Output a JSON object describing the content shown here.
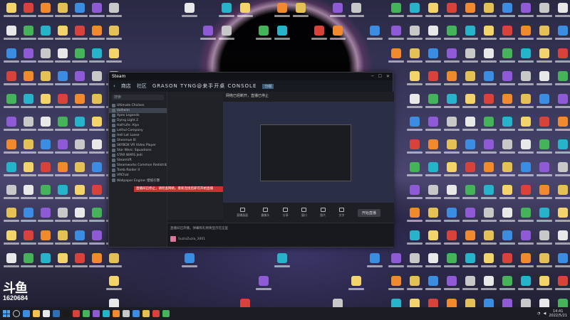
{
  "window": {
    "title": "Steam",
    "nav_store": "商店",
    "nav_community": "社区",
    "nav_user": "GRASON TYNG@来手开桌 CONSOLE",
    "nav_badge": "分组",
    "search_placeholder": "搜索",
    "games": [
      "Ultimate Chicken",
      "Valheim",
      "Apex Legends",
      "Dying Light 2",
      "Half-Life: Alyx",
      "Lethal Company",
      "Hell Let Loose",
      "Shenmue III",
      "SKYBOX VR Video Player",
      "Star Wars: Squadrons",
      "STAR WARS Jedi",
      "SteamVR",
      "Steamworks Common Redistributables",
      "Tomb Raider II",
      "VRChat",
      "Wallpaper Engine: 壁纸引擎"
    ],
    "stream_title": "网络已经断开，直播已停止",
    "red_banner_text": "直播间已停止，请检查网络，重新连接后即可开始直播",
    "toolbar": [
      {
        "icon": "screen-icon",
        "label": "直播画面"
      },
      {
        "icon": "camera-icon",
        "label": "摄像头"
      },
      {
        "icon": "share-icon",
        "label": "分享"
      },
      {
        "icon": "monitor-icon",
        "label": "窗口"
      },
      {
        "icon": "image-icon",
        "label": "图片"
      },
      {
        "icon": "text-icon",
        "label": "文字"
      }
    ],
    "start_label": "开始直播",
    "notice": "直播间已开播，弹幕和礼物将显示在这里",
    "user_label": "SuziaZuzia_3001"
  },
  "watermark": {
    "logo": "斗鱼",
    "number": "1620684"
  },
  "taskbar": {
    "time": "14:41",
    "date": "2022/5/21"
  }
}
